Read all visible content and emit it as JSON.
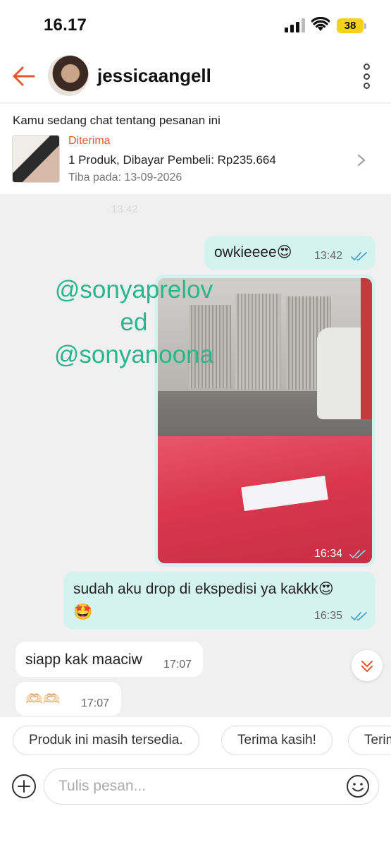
{
  "status_bar": {
    "time": "16.17",
    "battery": "38"
  },
  "header": {
    "username": "jessicaangell"
  },
  "order": {
    "intro": "Kamu sedang chat tentang pesanan ini",
    "status": "Diterima",
    "detail": "1 Produk, Dibayar Pembeli: Rp235.664",
    "arrival": "Tiba pada: 13-09-2026"
  },
  "ghost_time": "13:42",
  "messages": [
    {
      "side": "out",
      "text": "owkieeee😍",
      "time": "13:42"
    },
    {
      "side": "out",
      "type": "image",
      "time": "16:34"
    },
    {
      "side": "out",
      "text": "sudah aku drop di ekspedisi ya kakkk😍",
      "text2": "🤩",
      "time": "16:35"
    },
    {
      "side": "in",
      "text": "siapp kak maaciw",
      "time": "17:07"
    },
    {
      "side": "in",
      "text": "🫶🏻🫶🏻",
      "time": "17:07"
    }
  ],
  "watermark": {
    "line1": "@sonyaprelov",
    "line2": "ed",
    "line3": "@sonyanoona"
  },
  "quick_replies": [
    "Produk ini masih tersedia.",
    "Terima kasih!",
    "Terim"
  ],
  "input": {
    "placeholder": "Tulis pesan..."
  },
  "colors": {
    "accent": "#e4572e",
    "bubble_out": "#d5f3ee",
    "watermark": "#2bb58a",
    "tick": "#4aa3c8"
  }
}
